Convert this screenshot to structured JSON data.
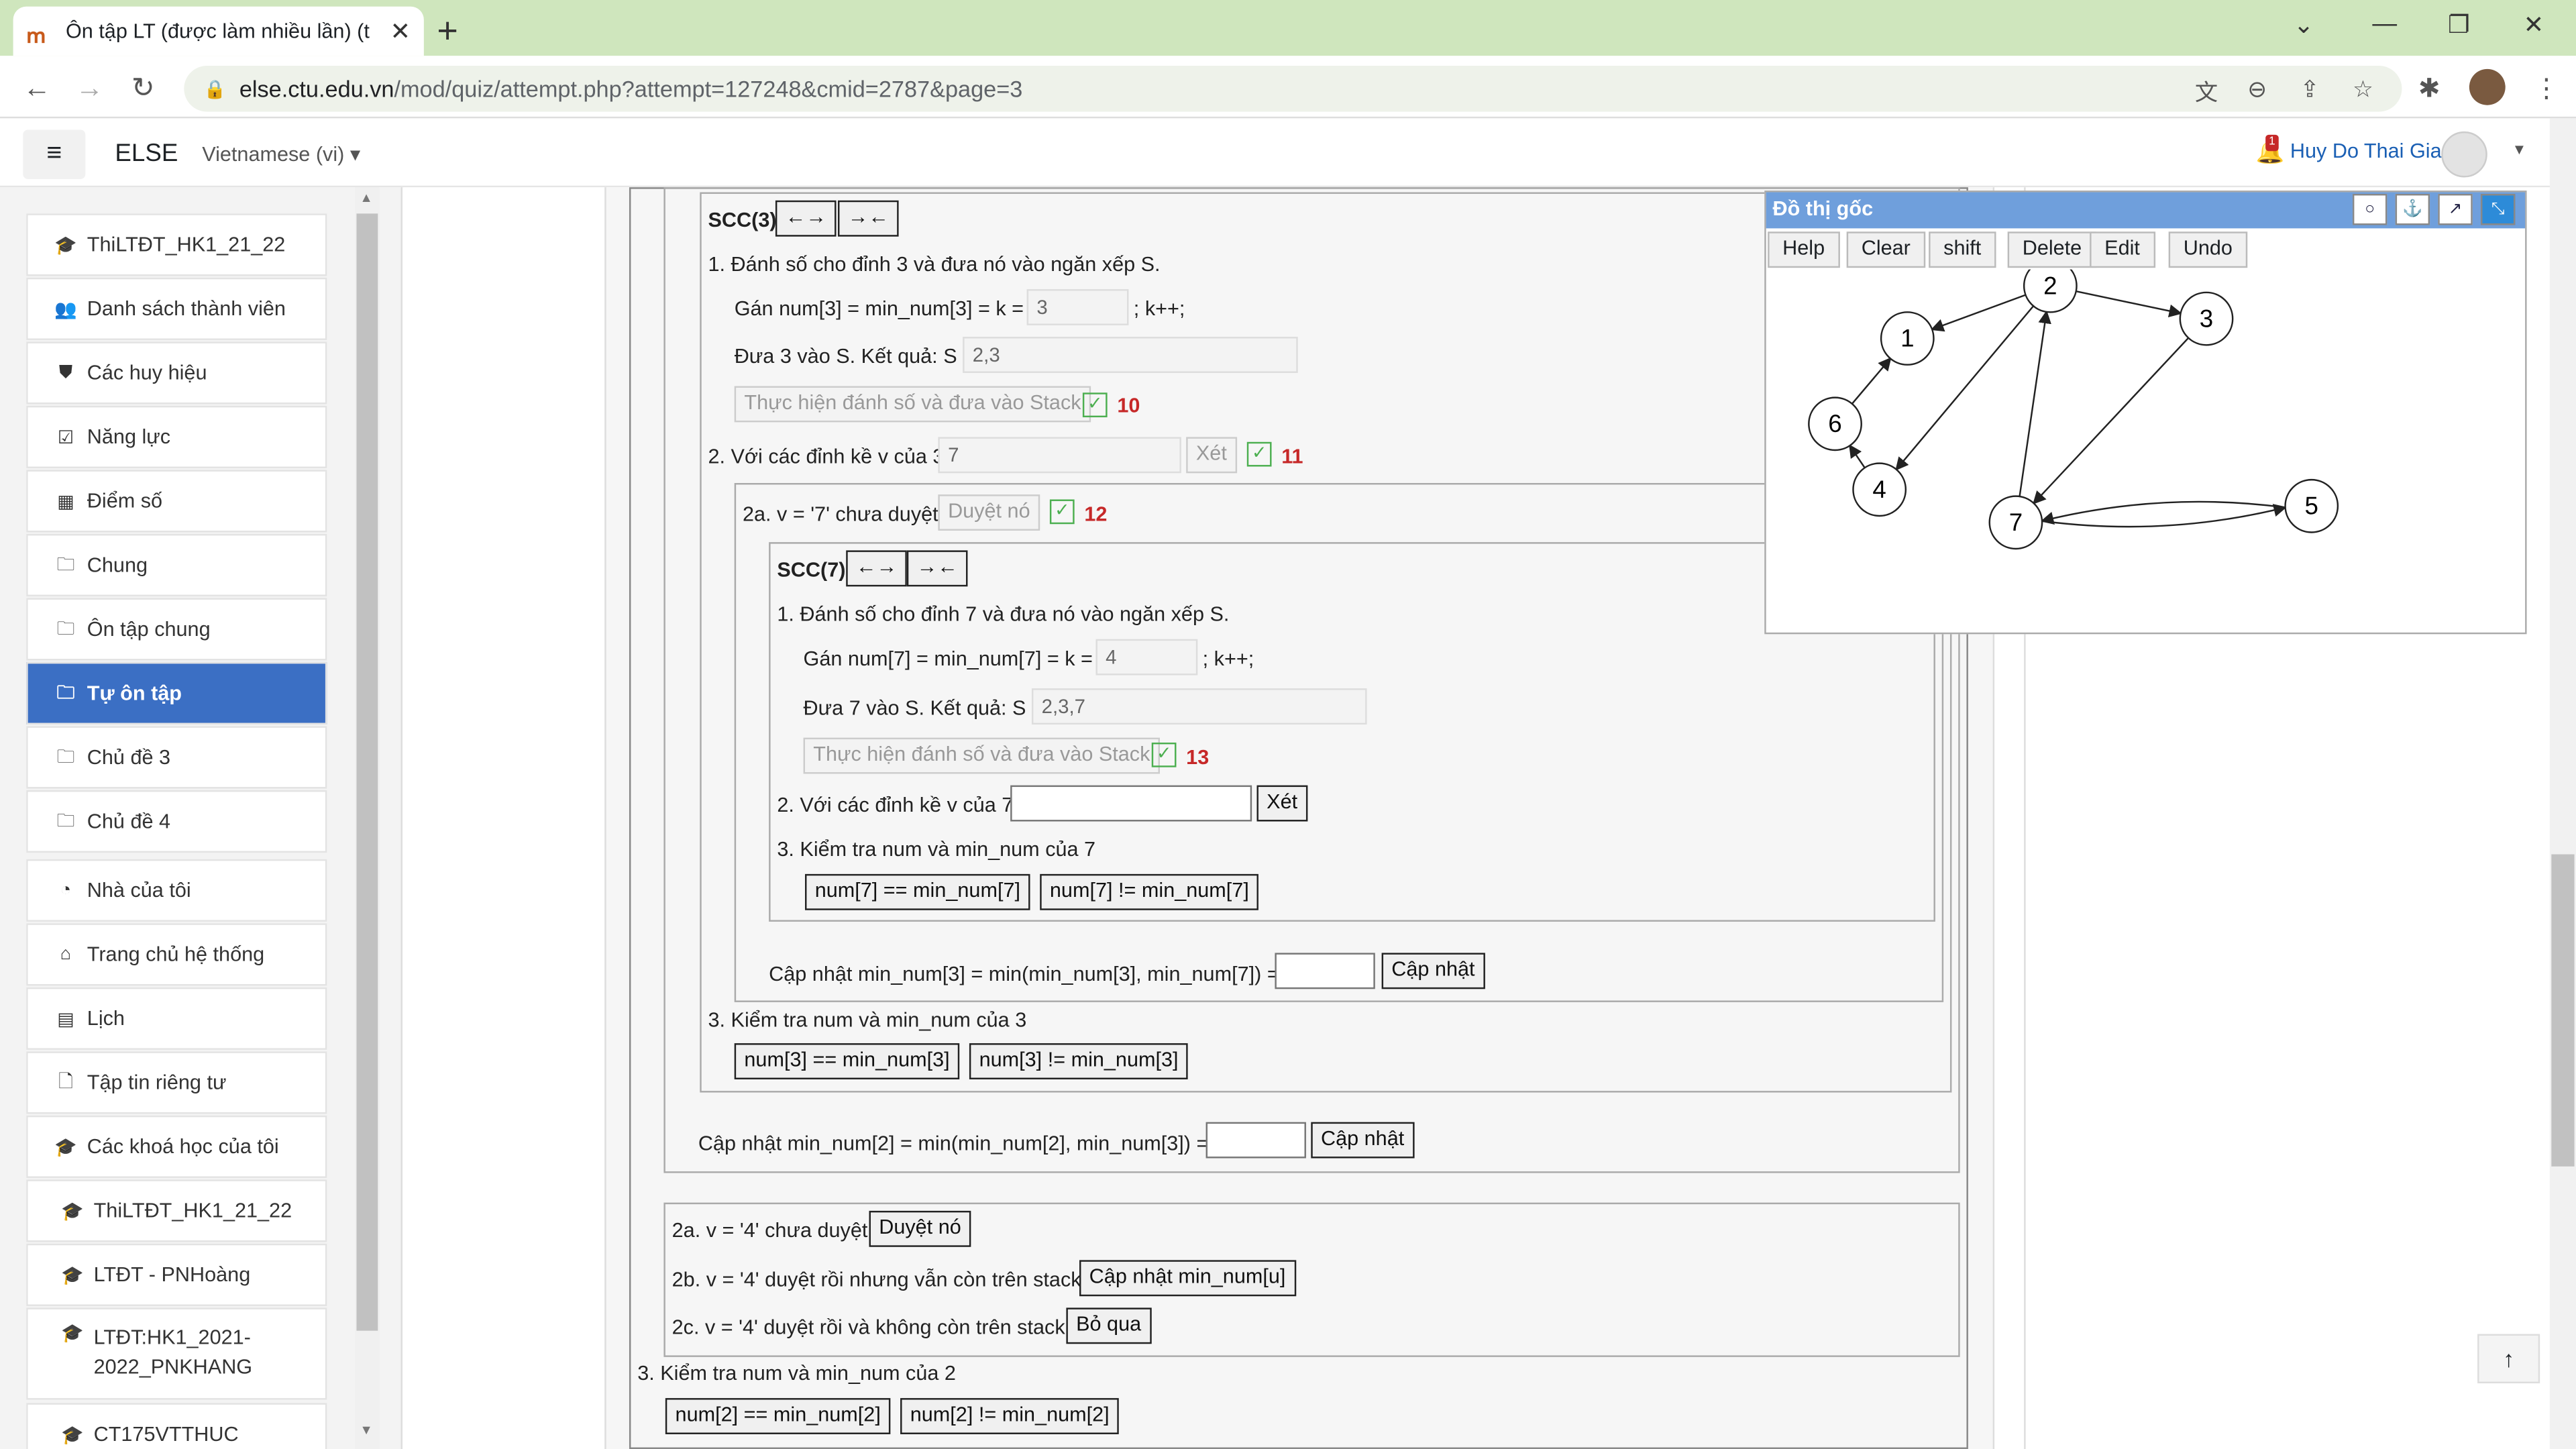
{
  "browser": {
    "tab_title": "Ôn tập LT (được làm nhiều lần) (t",
    "url_host": "else.ctu.edu.vn",
    "url_path": "/mod/quiz/attempt.php?attempt=127248&cmid=2787&page=3"
  },
  "header": {
    "brand": "ELSE",
    "language": "Vietnamese (vi)",
    "user": "Huy Do Thai Gia",
    "notifications": "1"
  },
  "sidebar": {
    "items": [
      {
        "label": "ThiLTĐT_HK1_21_22",
        "icon": "graduation-cap-icon"
      },
      {
        "label": "Danh sách thành viên",
        "icon": "users-icon"
      },
      {
        "label": "Các huy hiệu",
        "icon": "shield-icon"
      },
      {
        "label": "Năng lực",
        "icon": "check-square-icon"
      },
      {
        "label": "Điểm số",
        "icon": "table-icon"
      },
      {
        "label": "Chung",
        "icon": "folder-icon"
      },
      {
        "label": "Ôn tập chung",
        "icon": "folder-icon"
      },
      {
        "label": "Tự ôn tập",
        "icon": "folder-icon"
      },
      {
        "label": "Chủ đề 3",
        "icon": "folder-icon"
      },
      {
        "label": "Chủ đề 4",
        "icon": "folder-icon"
      },
      {
        "label": "Nhà của tôi",
        "icon": "dashboard-icon"
      },
      {
        "label": "Trang chủ hệ thống",
        "icon": "home-icon"
      },
      {
        "label": "Lịch",
        "icon": "calendar-icon"
      },
      {
        "label": "Tập tin riêng tư",
        "icon": "file-icon"
      },
      {
        "label": "Các khoá học của tôi",
        "icon": "graduation-cap-icon"
      },
      {
        "label": "ThiLTĐT_HK1_21_22",
        "icon": "graduation-cap-icon"
      },
      {
        "label": "LTĐT - PNHoàng",
        "icon": "graduation-cap-icon"
      },
      {
        "label": "LTĐT:HK1_2021-2022_PNKHANG",
        "icon": "graduation-cap-icon"
      },
      {
        "label": "CT175VTTHUC",
        "icon": "graduation-cap-icon"
      }
    ]
  },
  "scc3": {
    "title": "SCC(3)",
    "collapse_btn": "←→",
    "expand_btn": "→←",
    "step1": "1. Đánh số cho đỉnh 3 và đưa nó vào ngăn xếp S.",
    "assign_label": "Gán num[3] = min_num[3] = k =",
    "assign_value": "3",
    "assign_suffix": "; k++;",
    "push_label": "Đưa 3 vào S. Kết quả: S =",
    "push_value": "2,3",
    "do_btn": "Thực hiện đánh số và đưa vào Stack",
    "score1": "10",
    "step2": "2. Với các đỉnh kề v của 3:",
    "step2_value": "7",
    "xet_btn": "Xét",
    "score2": "11",
    "case2a": "2a. v = '7' chưa duyệt",
    "visit_btn": "Duyệt nó",
    "score3": "12",
    "step3": "3. Kiểm tra num và min_num của 3",
    "eq_btn": "num[3] == min_num[3]",
    "neq_btn": "num[3] != min_num[3]"
  },
  "scc7": {
    "title": "SCC(7)",
    "collapse_btn": "←→",
    "expand_btn": "→←",
    "step1": "1. Đánh số cho đỉnh 7 và đưa nó vào ngăn xếp S.",
    "assign_label": "Gán num[7] = min_num[7] = k =",
    "assign_value": "4",
    "assign_suffix": "; k++;",
    "push_label": "Đưa 7 vào S. Kết quả: S =",
    "push_value": "2,3,7",
    "do_btn": "Thực hiện đánh số và đưa vào Stack",
    "score1": "13",
    "step2": "2. Với các đỉnh kề v của 7:",
    "step2_value": "",
    "xet_btn": "Xét",
    "step3": "3. Kiểm tra num và min_num của 7",
    "eq_btn": "num[7] == min_num[7]",
    "neq_btn": "num[7] != min_num[7]"
  },
  "update3": {
    "label": "Cập nhật min_num[3] = min(min_num[3], min_num[7]) =",
    "value": "",
    "btn": "Cập nhật"
  },
  "update2": {
    "label": "Cập nhật min_num[2] = min(min_num[2], min_num[3]) =",
    "value": "",
    "btn": "Cập nhật"
  },
  "v4": {
    "case_a": "2a. v = '4' chưa duyệt",
    "btn_a": "Duyệt nó",
    "case_b": "2b. v = '4' duyệt rồi nhưng vẫn còn trên stack",
    "btn_b": "Cập nhật min_num[u]",
    "case_c": "2c. v = '4' duyệt rồi và không còn trên stack",
    "btn_c": "Bỏ qua"
  },
  "step3_2": {
    "label": "3. Kiểm tra num và min_num của 2",
    "eq_btn": "num[2] == min_num[2]",
    "neq_btn": "num[2] != min_num[2]"
  },
  "graph": {
    "title": "Đồ thị gốc",
    "buttons": [
      "Help",
      "Clear",
      "shift",
      "Delete",
      "Edit",
      "Undo"
    ],
    "nodes": [
      {
        "id": "1"
      },
      {
        "id": "2"
      },
      {
        "id": "3"
      },
      {
        "id": "4"
      },
      {
        "id": "5"
      },
      {
        "id": "6"
      },
      {
        "id": "7"
      }
    ],
    "edges": [
      [
        "2",
        "1"
      ],
      [
        "2",
        "3"
      ],
      [
        "2",
        "4"
      ],
      [
        "3",
        "7"
      ],
      [
        "7",
        "2"
      ],
      [
        "7",
        "5"
      ],
      [
        "5",
        "7"
      ],
      [
        "6",
        "1"
      ],
      [
        "4",
        "6"
      ]
    ]
  }
}
